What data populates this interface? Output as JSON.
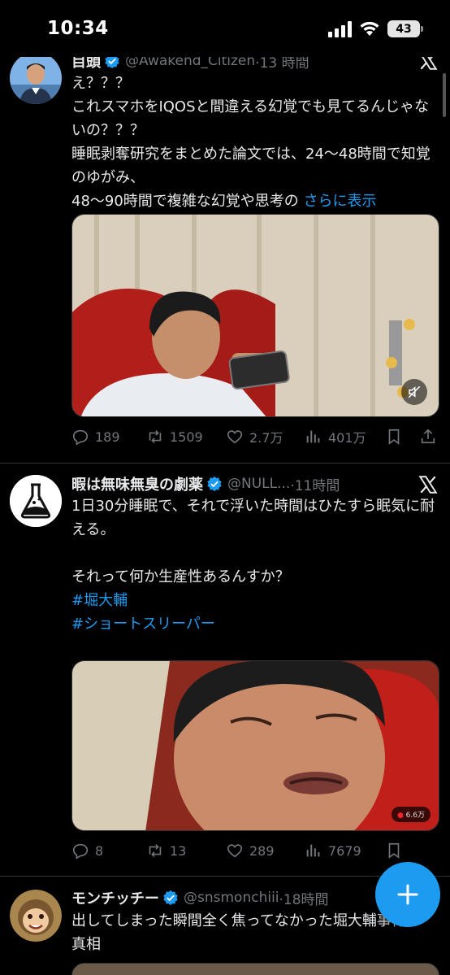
{
  "status_bar": {
    "time": "10:34",
    "battery": "43"
  },
  "tweets": [
    {
      "name": "目頭",
      "handle": "@Awakend_Citizen",
      "time": "·13 時間",
      "text": "え？？？\nこれスマホをIQOSと間違える幻覚でも見てるんじゃないの？？？\n睡眠剥奪研究をまとめた論文では、24〜48時間で知覚のゆがみ、\n48〜90時間で複雑な幻覚や思考の ",
      "show_more": "さらに表示",
      "stats": {
        "replies": "189",
        "reposts": "1509",
        "likes": "2.7万",
        "views": "401万"
      }
    },
    {
      "name": "暇は無味無臭の劇薬",
      "handle": "@NULL...",
      "time": "·11時間",
      "text": "1日30分睡眠で、それで浮いた時間はひたすら眠気に耐える。\n\nそれって何か生産性あるんすか？\n",
      "hashtags": [
        "#堀大輔",
        "#ショートスリーパー"
      ],
      "media_badge": "6.6万",
      "stats": {
        "replies": "8",
        "reposts": "13",
        "likes": "289",
        "views": "7679"
      }
    },
    {
      "name": "モンチッチー",
      "handle": "@snsmonchiii",
      "time": "·18時間",
      "text": "出してしまった瞬間全く焦ってなかった堀大輔事件の真相"
    }
  ],
  "icons": [
    "signal-icon",
    "wifi-icon",
    "battery-icon",
    "verified-badge-icon",
    "x-logo-icon",
    "reply-icon",
    "repost-icon",
    "like-icon",
    "views-icon",
    "bookmark-icon",
    "share-icon",
    "mute-icon",
    "compose-plus-icon"
  ],
  "colors": {
    "background": "#000000",
    "accent": "#1d9bf0",
    "muted": "#71767b",
    "text": "#e7e9ea"
  }
}
